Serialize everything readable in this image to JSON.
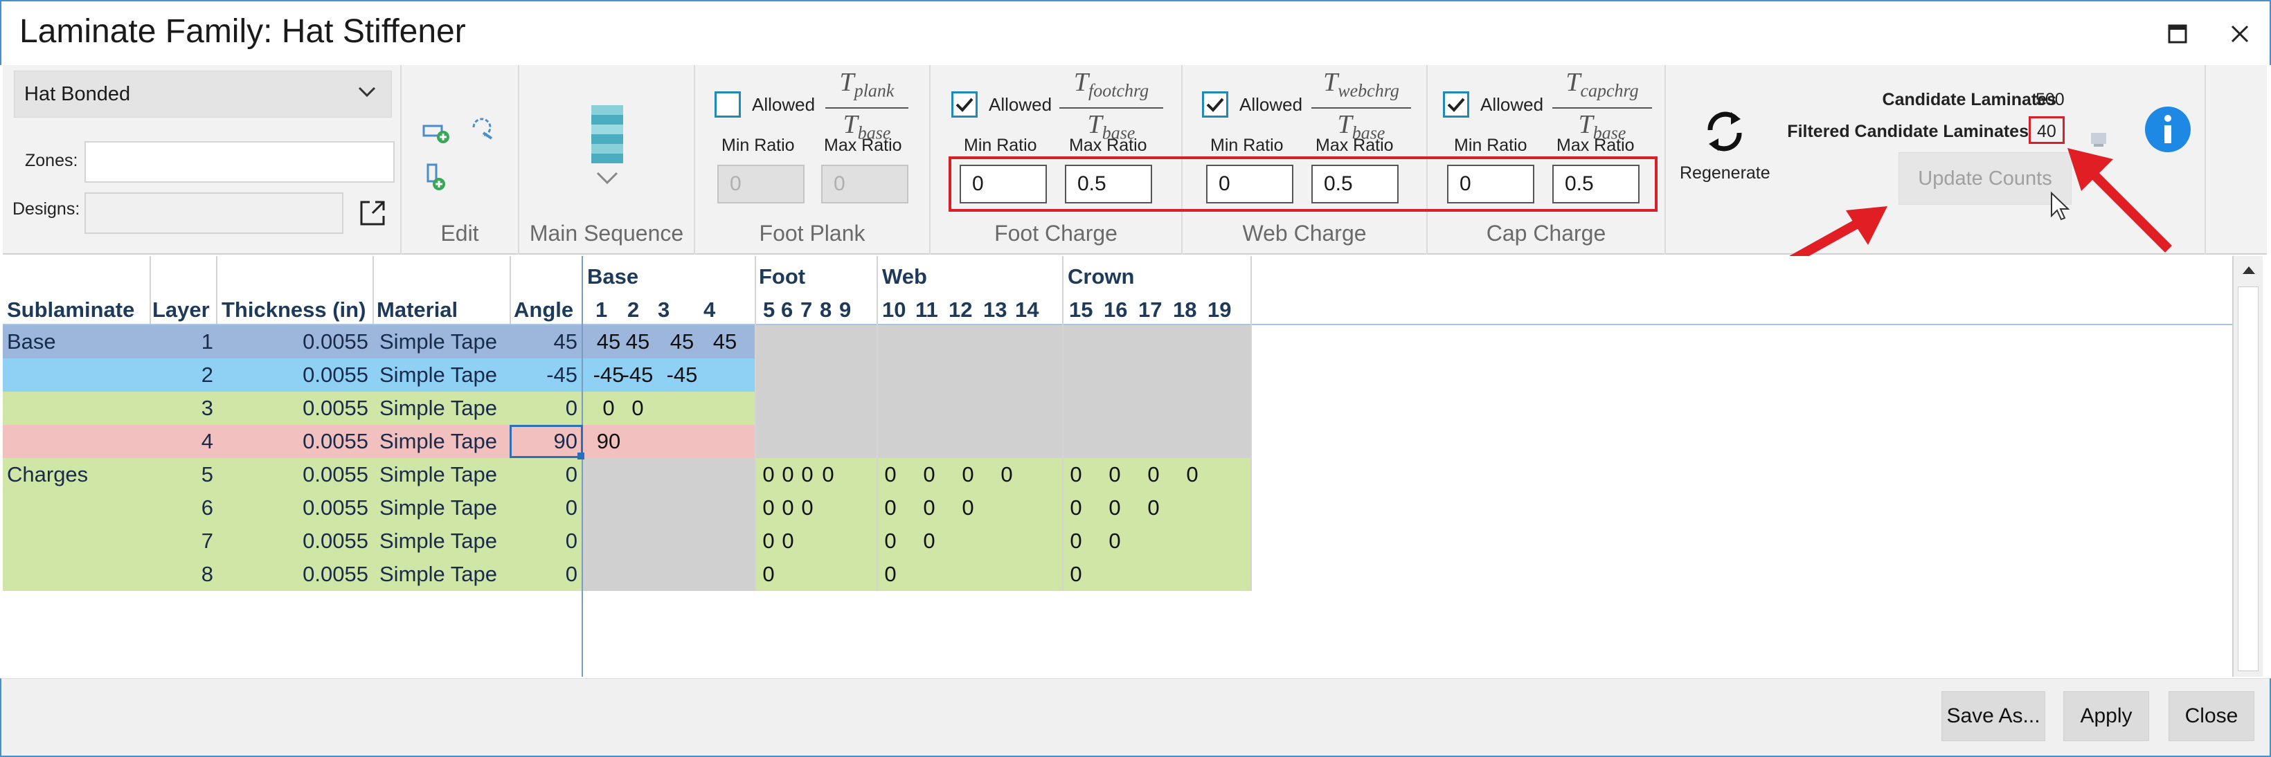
{
  "window": {
    "title": "Laminate Family: Hat Stiffener",
    "maximize_icon": "maximize-icon",
    "close_icon": "close-icon"
  },
  "ribbon": {
    "family_select": "Hat Bonded",
    "zones_label": "Zones:",
    "designs_label": "Designs:",
    "edit_label": "Edit",
    "main_sequence_label": "Main Sequence",
    "regenerate_label": "Regenerate",
    "groups": [
      {
        "label": "Foot Plank",
        "allowed": false,
        "allowed_label": "Allowed",
        "num": "T",
        "num_sub": "plank",
        "den": "T",
        "den_sub": "base",
        "min_label": "Min Ratio",
        "max_label": "Max Ratio",
        "min": "0",
        "max": "0"
      },
      {
        "label": "Foot Charge",
        "allowed": true,
        "allowed_label": "Allowed",
        "num": "T",
        "num_sub": "footchrg",
        "den": "T",
        "den_sub": "base",
        "min_label": "Min Ratio",
        "max_label": "Max Ratio",
        "min": "0",
        "max": "0.5"
      },
      {
        "label": "Web Charge",
        "allowed": true,
        "allowed_label": "Allowed",
        "num": "T",
        "num_sub": "webchrg",
        "den": "T",
        "den_sub": "base",
        "min_label": "Min Ratio",
        "max_label": "Max Ratio",
        "min": "0",
        "max": "0.5"
      },
      {
        "label": "Cap Charge",
        "allowed": true,
        "allowed_label": "Allowed",
        "num": "T",
        "num_sub": "capchrg",
        "den": "T",
        "den_sub": "base",
        "min_label": "Min Ratio",
        "max_label": "Max Ratio",
        "min": "0",
        "max": "0.5"
      }
    ],
    "candidate_label": "Candidate Laminates",
    "candidate_value": "500",
    "filtered_label": "Filtered Candidate Laminates",
    "filtered_value": "40",
    "update_counts": "Update Counts"
  },
  "grid": {
    "group_headers": [
      "Base",
      "Foot",
      "Web",
      "Crown"
    ],
    "columns": [
      "Sublaminate",
      "Layer",
      "Thickness (in)",
      "Material",
      "Angle"
    ],
    "ply_numbers": [
      "1",
      "2",
      "3",
      "4",
      "5",
      "6",
      "7",
      "8",
      "9",
      "10",
      "11",
      "12",
      "13",
      "14",
      "15",
      "16",
      "17",
      "18",
      "19"
    ],
    "rows": [
      {
        "sublaminate": "Base",
        "layer": "1",
        "thickness": "0.0055",
        "material": "Simple Tape",
        "angle": "45",
        "vals": [
          "45",
          "45",
          "45",
          "45"
        ]
      },
      {
        "sublaminate": "",
        "layer": "2",
        "thickness": "0.0055",
        "material": "Simple Tape",
        "angle": "-45",
        "vals": [
          "-45",
          "-45",
          "-45"
        ]
      },
      {
        "sublaminate": "",
        "layer": "3",
        "thickness": "0.0055",
        "material": "Simple Tape",
        "angle": "0",
        "vals": [
          "0",
          "0"
        ]
      },
      {
        "sublaminate": "",
        "layer": "4",
        "thickness": "0.0055",
        "material": "Simple Tape",
        "angle": "90",
        "vals": [
          "90"
        ]
      },
      {
        "sublaminate": "Charges",
        "layer": "5",
        "thickness": "0.0055",
        "material": "Simple Tape",
        "angle": "0",
        "foot": [
          "0",
          "0",
          "0",
          "0"
        ],
        "web": [
          "0",
          "0",
          "0",
          "0"
        ],
        "crown": [
          "0",
          "0",
          "0",
          "0"
        ]
      },
      {
        "sublaminate": "",
        "layer": "6",
        "thickness": "0.0055",
        "material": "Simple Tape",
        "angle": "0",
        "foot": [
          "0",
          "0",
          "0"
        ],
        "web": [
          "0",
          "0",
          "0"
        ],
        "crown": [
          "0",
          "0",
          "0"
        ]
      },
      {
        "sublaminate": "",
        "layer": "7",
        "thickness": "0.0055",
        "material": "Simple Tape",
        "angle": "0",
        "foot": [
          "0",
          "0"
        ],
        "web": [
          "0",
          "0"
        ],
        "crown": [
          "0",
          "0"
        ]
      },
      {
        "sublaminate": "",
        "layer": "8",
        "thickness": "0.0055",
        "material": "Simple Tape",
        "angle": "0",
        "foot": [
          "0"
        ],
        "web": [
          "0"
        ],
        "crown": [
          "0"
        ]
      }
    ]
  },
  "footer": {
    "save_as": "Save As...",
    "apply": "Apply",
    "close": "Close"
  },
  "colors": {
    "accent": "#1e8ab5",
    "highlight": "#d8202a",
    "row_base1": "#9db7dc",
    "row_base2": "#8fd0f5",
    "row_green": "#cfe6a6",
    "row_pink": "#f3c0c0",
    "info": "#1e88e5"
  }
}
